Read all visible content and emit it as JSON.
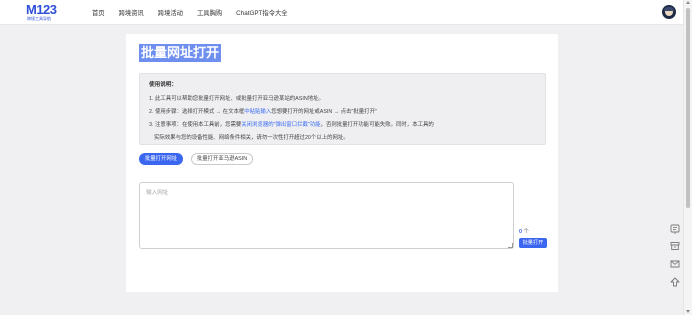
{
  "brand": {
    "logo_text": "M123",
    "logo_subtext": "跨境工具导航"
  },
  "nav": {
    "items": [
      {
        "label": "首页"
      },
      {
        "label": "跨境资讯"
      },
      {
        "label": "跨境活动"
      },
      {
        "label": "工具胸购"
      },
      {
        "label": "ChatGPT指令大全"
      }
    ]
  },
  "page": {
    "title": "批量网址打开"
  },
  "instructions": {
    "heading": "使用说明：",
    "line1": "1. 此工具可以帮助您批量打开网址、或批量打开亚马逊某站的ASIN地址。",
    "line2_a": "2. 使用步骤：选择打开模式 → 在文本框",
    "line2_highlight": "中粘贴输入",
    "line2_b": "您想要打开的网址或ASIN → 点击\"批量打开\"",
    "line3_a": "3. 注意事项：在使用本工具前，您需要",
    "line3_highlight": "关闭浏览器的\"弹出窗口拦截\"功能",
    "line3_b": "，否则批量打开功能可能失败。同时，本工具的",
    "line4": "实际效果与您的设备性能、网络条件相关，请勿一次性打开超过20个以上的网址。"
  },
  "tabs": [
    {
      "label": "批量打开网址",
      "active": true
    },
    {
      "label": "批量打开亚马逊ASIN",
      "active": false
    }
  ],
  "input": {
    "placeholder": "输入网址",
    "value": ""
  },
  "counter": {
    "count": "0",
    "unit": "个"
  },
  "submit": {
    "label": "批量打开"
  },
  "side_tools": [
    "feedback-icon",
    "archive-icon",
    "message-icon",
    "back-to-top-icon"
  ],
  "colors": {
    "accent": "#3b66f0",
    "title_highlight": "#6f8ff0",
    "page_bg": "#f0f0f2"
  }
}
